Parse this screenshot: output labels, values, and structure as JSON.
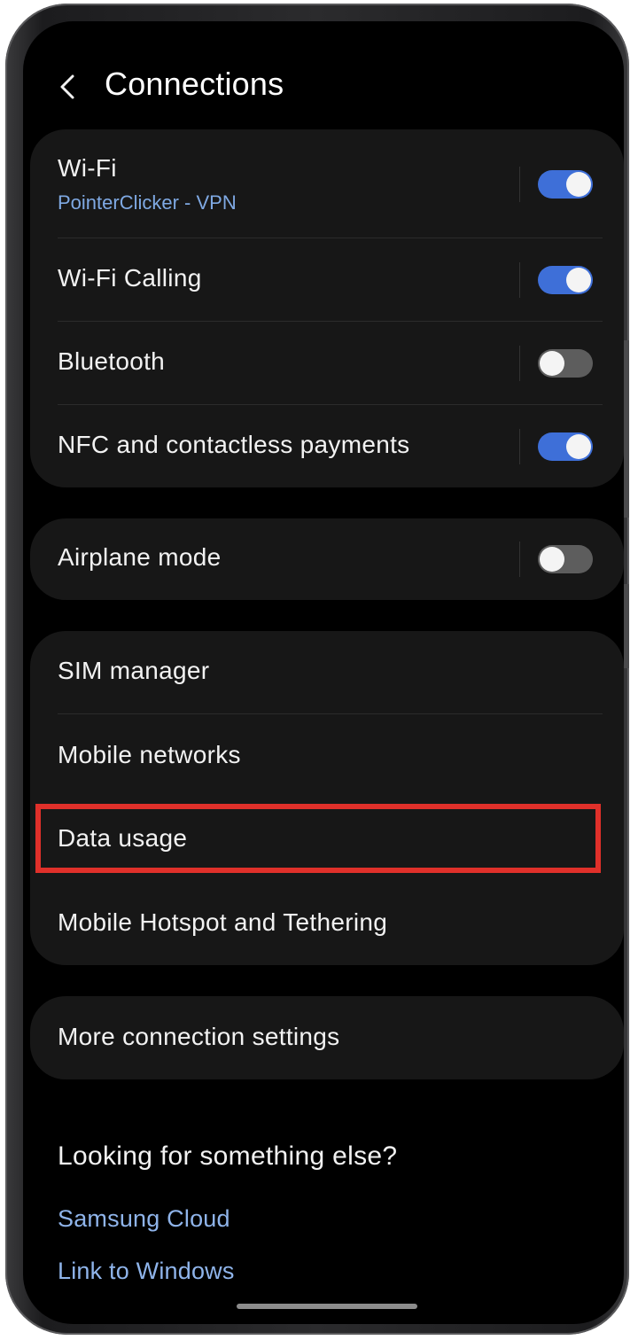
{
  "header": {
    "title": "Connections",
    "back_icon": "chevron-left-icon"
  },
  "groups": [
    {
      "items": [
        {
          "label": "Wi-Fi",
          "sublabel": "PointerClicker - VPN",
          "toggle": true
        },
        {
          "label": "Wi-Fi Calling",
          "toggle": true
        },
        {
          "label": "Bluetooth",
          "toggle": false
        },
        {
          "label": "NFC and contactless payments",
          "toggle": true
        }
      ]
    },
    {
      "items": [
        {
          "label": "Airplane mode",
          "toggle": false
        }
      ]
    },
    {
      "items": [
        {
          "label": "SIM manager"
        },
        {
          "label": "Mobile networks"
        },
        {
          "label": "Data usage",
          "highlighted": true
        },
        {
          "label": "Mobile Hotspot and Tethering"
        }
      ]
    },
    {
      "items": [
        {
          "label": "More connection settings"
        }
      ]
    }
  ],
  "suggestions": {
    "heading": "Looking for something else?",
    "links": [
      "Samsung Cloud",
      "Link to Windows"
    ]
  },
  "colors": {
    "toggle_on": "#3e6fd8",
    "toggle_off": "#5d5d5d",
    "link": "#8fb4ea",
    "sublabel": "#7fa9e3",
    "highlight": "#e0302a",
    "background": "#000000",
    "card": "#171717"
  }
}
